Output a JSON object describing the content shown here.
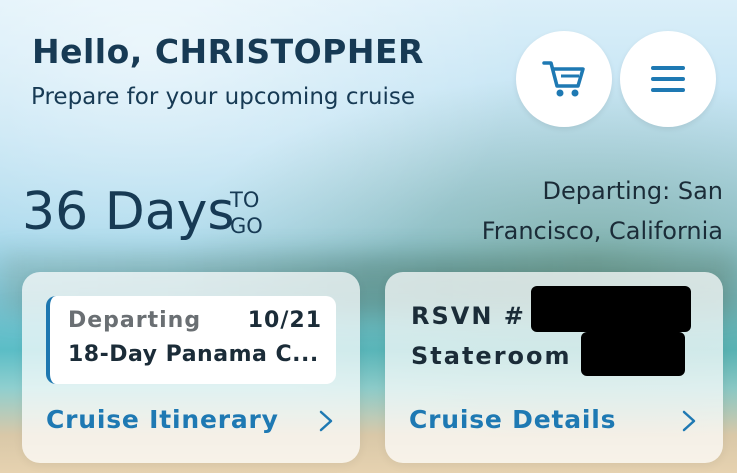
{
  "header": {
    "greeting": "Hello, CHRISTOPHER",
    "subtitle": "Prepare for your upcoming cruise"
  },
  "actions": {
    "cart_icon": "cart-icon",
    "menu_icon": "hamburger-menu-icon"
  },
  "countdown": {
    "days": "36 Days",
    "to": "TO",
    "go": "GO"
  },
  "departure": {
    "text": "Departing: San Francisco, California"
  },
  "itinerary_card": {
    "departing_label": "Departing",
    "date": "10/21",
    "cruise_name": "18-Day Panama C...",
    "link_label": "Cruise Itinerary"
  },
  "details_card": {
    "rsvn_label": "RSVN #",
    "stateroom_label": "Stateroom",
    "link_label": "Cruise Details"
  },
  "colors": {
    "primary_text": "#173a54",
    "accent": "#1e79b3"
  }
}
